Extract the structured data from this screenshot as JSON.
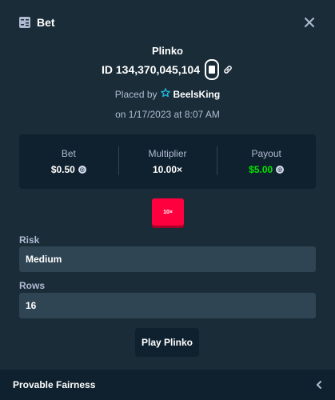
{
  "header": {
    "title": "Bet",
    "icon": "bet-slip-icon",
    "close_icon": "close-icon"
  },
  "bet": {
    "game": "Plinko",
    "id_text": "ID 134,370,045,104",
    "placed_by_label": "Placed by",
    "user": "BeelsKing",
    "date_text": "on 1/17/2023 at 8:07 AM"
  },
  "stats": {
    "bet_label": "Bet",
    "bet_value": "$0.50",
    "multiplier_label": "Multiplier",
    "multiplier_value": "10.00×",
    "payout_label": "Payout",
    "payout_value": "$5.00"
  },
  "result_chip": "10×",
  "risk": {
    "label": "Risk",
    "value": "Medium"
  },
  "rows": {
    "label": "Rows",
    "value": "16"
  },
  "play_button": "Play Plinko",
  "footer": {
    "title": "Provable Fairness",
    "icon": "chevron-left-icon"
  },
  "colors": {
    "background": "#1a2c38",
    "panel": "#0f212e",
    "input": "#2f4553",
    "payout_green": "#00e701",
    "chip_red": "#ff003f"
  }
}
